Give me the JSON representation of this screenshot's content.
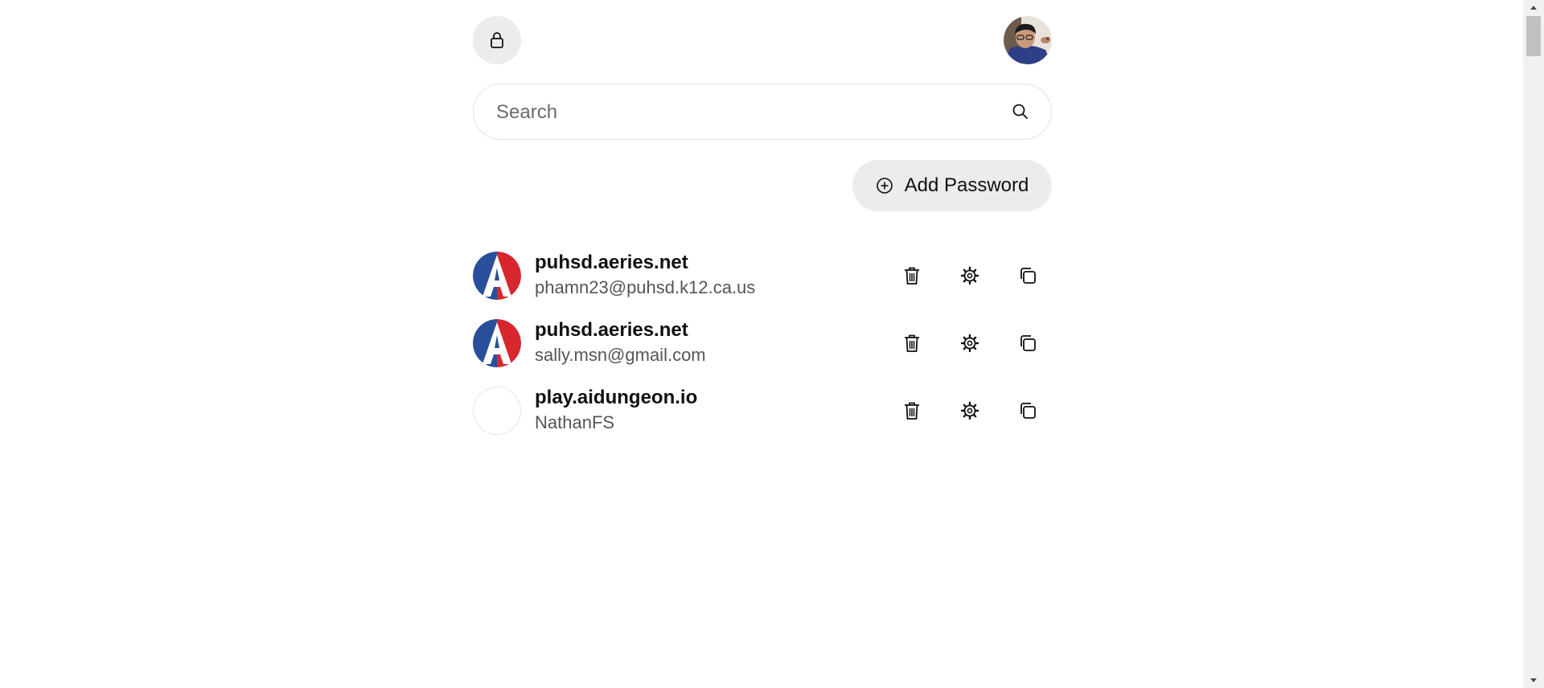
{
  "header": {
    "lock_icon": "lock-icon",
    "avatar_alt": "User avatar"
  },
  "search": {
    "placeholder": "Search",
    "value": "",
    "icon": "search-icon"
  },
  "add_password": {
    "label": "Add Password",
    "icon": "plus-circle-icon"
  },
  "passwords": [
    {
      "site": "puhsd.aeries.net",
      "username": "phamn23@puhsd.k12.ca.us",
      "logo": "aeries-logo"
    },
    {
      "site": "puhsd.aeries.net",
      "username": "sally.msn@gmail.com",
      "logo": "aeries-logo"
    },
    {
      "site": "play.aidungeon.io",
      "username": "NathanFS",
      "logo": "blank"
    }
  ],
  "row_actions": [
    "trash-icon",
    "gear-icon",
    "copy-icon"
  ],
  "colors": {
    "button_bg": "#ececec",
    "border": "#e2e2e2",
    "aeries_blue": "#2a4f9a",
    "aeries_red": "#d8262f"
  }
}
